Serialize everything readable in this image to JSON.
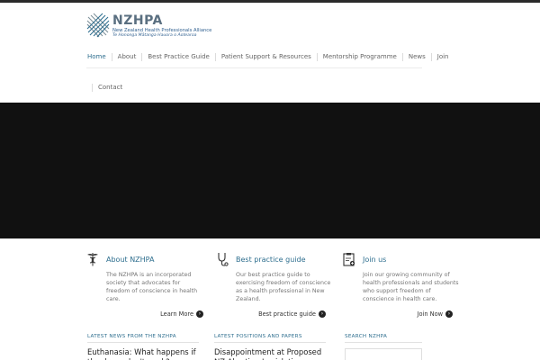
{
  "brand": {
    "name": "NZHPA",
    "tagline": "New Zealand Health Professionals Alliance",
    "maori": "Te Hononga Mātanga Hauora o Aotearoa"
  },
  "nav": {
    "items": [
      "Home",
      "About",
      "Best Practice Guide",
      "Patient Support & Resources",
      "Mentorship Programme",
      "News",
      "Join"
    ],
    "contact": "Contact"
  },
  "features": [
    {
      "title": "About NZHPA",
      "body": "The NZHPA is an incorporated society that advocates for freedom of conscience in health care.",
      "link": "Learn More",
      "icon": "caduceus-icon"
    },
    {
      "title": "Best practice guide",
      "body": "Our best practice guide to exercising freedom of conscience as a health professional in New Zealand.",
      "link": "Best practice guide",
      "icon": "stethoscope-icon"
    },
    {
      "title": "Join us",
      "body": "Join our growing community of health professionals and students who support freedom of conscience in health care.",
      "link": "Join Now",
      "icon": "clipboard-icon"
    }
  ],
  "columns": {
    "news": {
      "heading": "Latest News from the NZHPA",
      "post": "Euthanasia: What happens if the drugs don't work?"
    },
    "positions": {
      "heading": "Latest Positions and Papers",
      "post": "Disappointment at Proposed NZ Abortion Legislation"
    },
    "search": {
      "heading": "Search NZHPA"
    }
  },
  "colors": {
    "accent": "#2f6f8f",
    "hero": "#111111"
  }
}
